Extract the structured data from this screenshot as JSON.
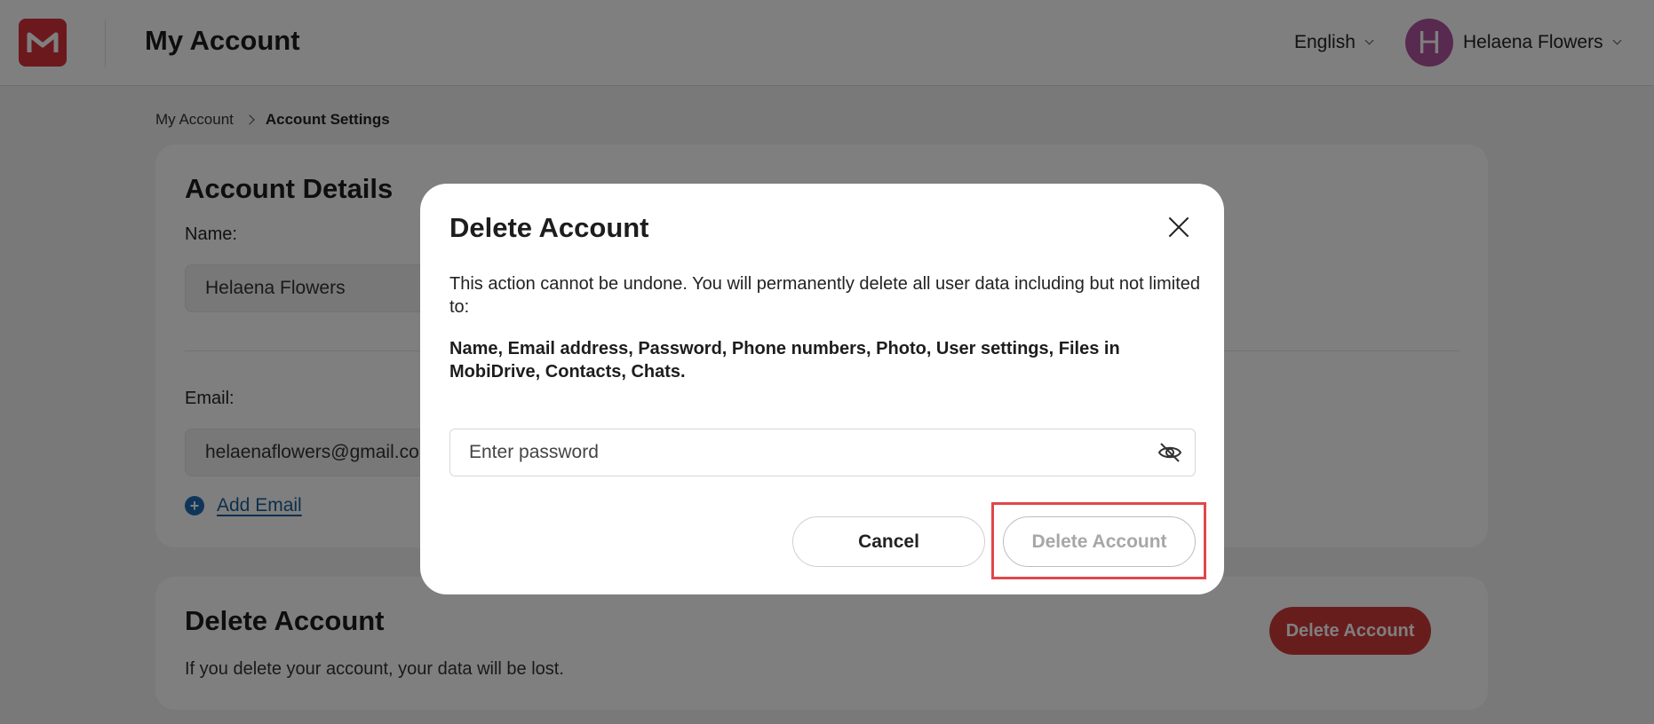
{
  "header": {
    "app_title": "My Account",
    "language": "English",
    "user_initial": "H",
    "user_name": "Helaena Flowers"
  },
  "breadcrumb": {
    "parent": "My Account",
    "current": "Account Settings"
  },
  "account_details": {
    "title": "Account Details",
    "name_label": "Name:",
    "name_value": "Helaena Flowers",
    "email_label": "Email:",
    "email_value": "helaenaflowers@gmail.com",
    "add_email_label": "Add Email"
  },
  "delete_section": {
    "title": "Delete Account",
    "description": "If you delete your account, your data will be lost.",
    "button_label": "Delete Account"
  },
  "modal": {
    "title": "Delete Account",
    "message": "This action cannot be undone. You will permanently delete all user data including but not limited to:",
    "data_list": "Name, Email address, Password, Phone numbers, Photo, User settings, Files in MobiDrive, Contacts, Chats.",
    "password_placeholder": "Enter password",
    "cancel_label": "Cancel",
    "delete_label": "Delete Account"
  },
  "colors": {
    "brand": "#d8323c",
    "danger": "#d13b3b",
    "link": "#1b5f99",
    "highlight": "#e0474b"
  }
}
